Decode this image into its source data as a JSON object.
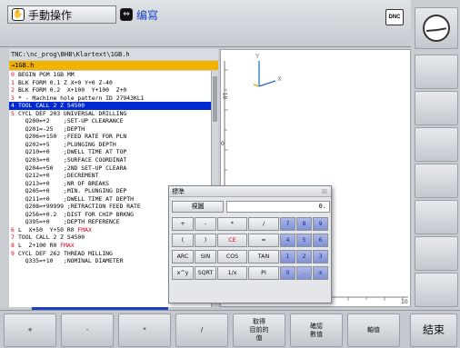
{
  "header": {
    "mode_left_label": "手動操作",
    "mode_left_icon": "hand-icon",
    "mode_right_label": "编寫",
    "mode_right_icon": "program-edit-icon",
    "dnc_label": "DNC"
  },
  "program": {
    "path": "TNC:\\nc_prog\\BHB\\Klartext\\1GB.h",
    "file_marker": "→1GB.h",
    "lines": [
      {
        "n": "0",
        "t": "BEGIN PGM 1GB MM"
      },
      {
        "n": "1",
        "t": "BLK FORM 0.1 Z X+0 Y+0 Z-40"
      },
      {
        "n": "2",
        "t": "BLK FORM 0.2  X+100  Y+100  Z+0"
      },
      {
        "n": "3",
        "t": "* - Machine hole pattern ID 27943KL1"
      },
      {
        "n": "4",
        "t": "TOOL CALL 2 Z S4500",
        "selected": true
      },
      {
        "n": "5",
        "t": "CYCL DEF 203 UNIVERSAL DRILLING"
      },
      {
        "n": "",
        "t": "  Q200=+2    ;SET-UP CLEARANCE"
      },
      {
        "n": "",
        "t": "  Q201=-25   ;DEPTH"
      },
      {
        "n": "",
        "t": "  Q206=+150  ;FEED RATE FOR PLN"
      },
      {
        "n": "",
        "t": "  Q202=+5    ;PLUNGING DEPTH"
      },
      {
        "n": "",
        "t": "  Q210=+0    ;DWELL TIME AT TOP"
      },
      {
        "n": "",
        "t": "  Q203=+0    ;SURFACE COORDINAT"
      },
      {
        "n": "",
        "t": "  Q204=+50   ;2ND SET-UP CLEARA"
      },
      {
        "n": "",
        "t": "  Q212=+0    ;DECREMENT"
      },
      {
        "n": "",
        "t": "  Q213=+0    ;NR OF BREAKS"
      },
      {
        "n": "",
        "t": "  Q205=+0    ;MIN. PLUNGING DEP"
      },
      {
        "n": "",
        "t": "  Q211=+0    ;DWELL TIME AT DEPTH"
      },
      {
        "n": "",
        "t": "  Q208=+99999 ;RETRACTION FEED RATE"
      },
      {
        "n": "",
        "t": "  Q256=+0.2  ;DIST FOR CHIP BRKNG"
      },
      {
        "n": "",
        "t": "  Q395=+0    ;DEPTH REFERENCE"
      },
      {
        "n": "6",
        "t": "L  X+50  Y+50 R0 ",
        "kw": "FMAX"
      },
      {
        "n": "7",
        "t": "TOOL CALL 2 Z S4500"
      },
      {
        "n": "8",
        "t": "L  Z+100 R0 ",
        "kw": "FMAX"
      },
      {
        "n": "9",
        "t": "CYCL DEF 262 THREAD MILLING"
      },
      {
        "n": "",
        "t": "  Q335=+10   ;NOMINAL DIAMETER"
      }
    ]
  },
  "graphic": {
    "axis_x_label": "X",
    "axis_y_label": "Y",
    "x_tick_label_50": "50",
    "x_tick_label_0": "0",
    "x_tick_label_end": "10",
    "y_tick_label_top": "10",
    "y_tick_label_0": "0",
    "y_tick_label_low": "0"
  },
  "calculator": {
    "title": "標準",
    "close_label": "☒",
    "mode_button": "視圖",
    "display_value": "0.",
    "rows": [
      [
        "+",
        "-",
        "*",
        "/",
        "7",
        "8",
        "9"
      ],
      [
        "(",
        ")",
        "CE",
        "=",
        "4",
        "5",
        "6"
      ],
      [
        "ARC",
        "SIN",
        "COS",
        "TAN",
        "1",
        "2",
        "3"
      ],
      [
        "x^y",
        "SQRT",
        "1/x",
        "PI",
        "0",
        ".",
        "±"
      ]
    ]
  },
  "softkeys_bottom": [
    "+",
    "-",
    "*",
    "/",
    "取得\n目前的\n值",
    "確認\n數值",
    "軸值",
    "結束"
  ],
  "softkeys_right": [
    "clock",
    "",
    "",
    "",
    "",
    "",
    "",
    ""
  ]
}
